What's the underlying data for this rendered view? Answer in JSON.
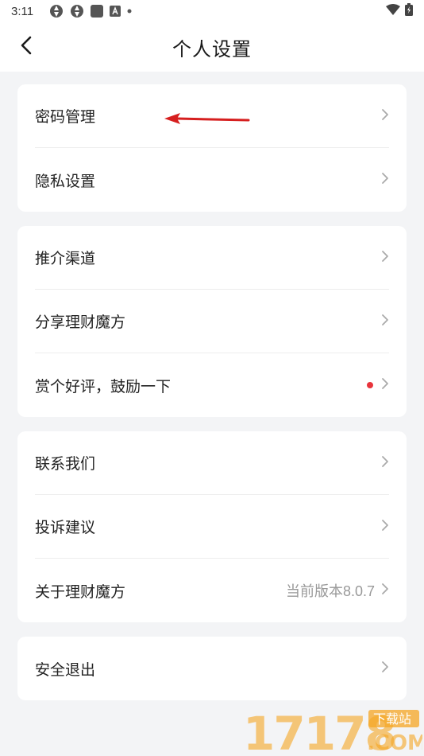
{
  "status_bar": {
    "time": "3:11",
    "icons": [
      "aperture-icon",
      "aperture-icon",
      "square-app-icon",
      "a-badge-icon",
      "dot-icon"
    ],
    "right_icons": [
      "wifi-icon",
      "battery-charging-icon"
    ]
  },
  "nav": {
    "back_icon": "chevron-left-icon",
    "title": "个人设置"
  },
  "groups": [
    {
      "items": [
        {
          "label": "密码管理",
          "value": "",
          "badge": false
        },
        {
          "label": "隐私设置",
          "value": "",
          "badge": false
        }
      ]
    },
    {
      "items": [
        {
          "label": "推介渠道",
          "value": "",
          "badge": false
        },
        {
          "label": "分享理财魔方",
          "value": "",
          "badge": false
        },
        {
          "label": "赏个好评，鼓励一下",
          "value": "",
          "badge": true
        }
      ]
    },
    {
      "items": [
        {
          "label": "联系我们",
          "value": "",
          "badge": false
        },
        {
          "label": "投诉建议",
          "value": "",
          "badge": false
        },
        {
          "label": "关于理财魔方",
          "value": "当前版本8.0.7",
          "badge": false
        }
      ]
    },
    {
      "items": [
        {
          "label": "安全退出",
          "value": "",
          "badge": false
        }
      ]
    }
  ],
  "watermark": {
    "number": "17178",
    "tag": "下载站",
    "suffix": ".COM"
  },
  "colors": {
    "background": "#f3f4f6",
    "card": "#ffffff",
    "badge": "#e8343c",
    "annotation_arrow": "#d61f1f",
    "watermark_orange": "#f5a623"
  }
}
